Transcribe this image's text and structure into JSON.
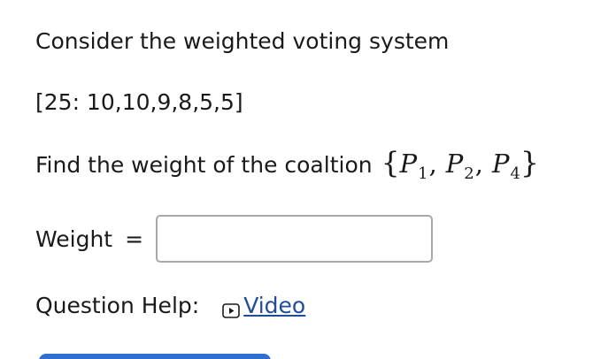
{
  "question": {
    "intro": "Consider the weighted voting system",
    "system": "[25: 10,10,9,8,5,5]",
    "prompt": "Find the weight of the coaltion",
    "coalition": {
      "open_brace": "{",
      "close_brace": "}",
      "players": [
        {
          "letter": "P",
          "sub": "1",
          "sep": ","
        },
        {
          "letter": "P",
          "sub": "2",
          "sep": ","
        },
        {
          "letter": "P",
          "sub": "4",
          "sep": ""
        }
      ]
    }
  },
  "answer": {
    "label": "Weight",
    "equals": "=",
    "value": "",
    "placeholder": ""
  },
  "help": {
    "label": "Question Help:",
    "video_label": "Video",
    "icon": "play-icon"
  },
  "colors": {
    "link": "#1f4d9c",
    "input_border": "#a9a9a9",
    "button": "#2f6fd2"
  }
}
